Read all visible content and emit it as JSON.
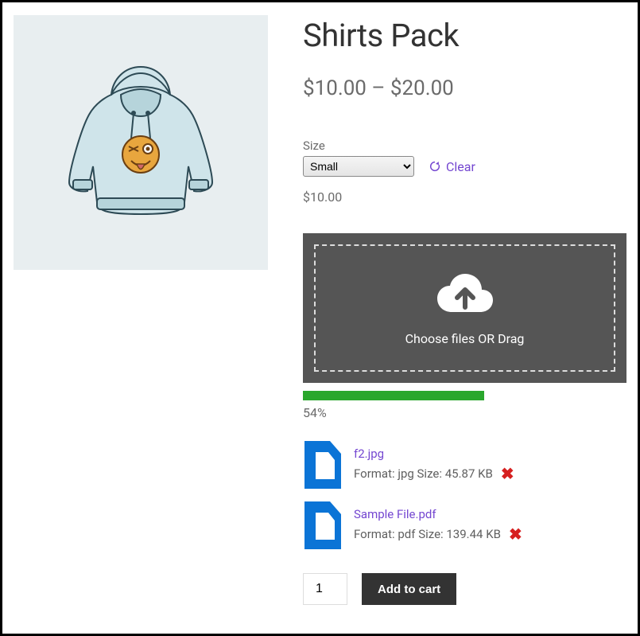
{
  "product": {
    "title": "Shirts Pack",
    "price_range": "$10.00 – $20.00",
    "chosen_price": "$10.00"
  },
  "variation": {
    "label": "Size",
    "options": [
      "Small"
    ],
    "selected": "Small",
    "clear_label": "Clear"
  },
  "upload": {
    "prompt": "Choose files OR Drag",
    "progress_percent": "54%"
  },
  "files": [
    {
      "name": "f2.jpg",
      "format": "jpg",
      "size": "45.87 KB"
    },
    {
      "name": "Sample File.pdf",
      "format": "pdf",
      "size": "139.44 KB"
    }
  ],
  "cart": {
    "quantity": "1",
    "add_label": "Add to cart"
  }
}
